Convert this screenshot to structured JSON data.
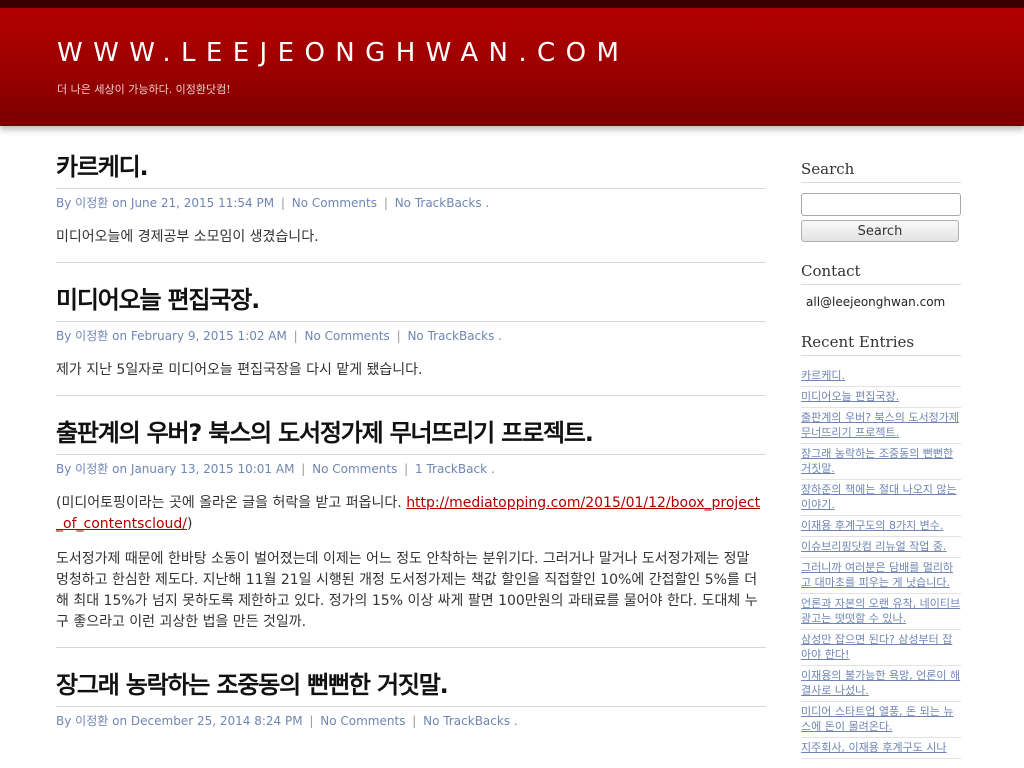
{
  "header": {
    "site_title": "WWW.LEEJEONGHWAN.COM",
    "tagline": "더 나은 세상이 가능하다. 이정환닷컴!"
  },
  "posts": [
    {
      "title": "카르케디.",
      "meta": {
        "by": "By",
        "author": "이정환",
        "on": "on",
        "date": "June 21, 2015 11:54 PM",
        "comments": "No Comments",
        "trackbacks": "No TrackBacks",
        "end": "."
      },
      "body": [
        "미디어오늘에 경제공부 소모임이 생겼습니다."
      ]
    },
    {
      "title": "미디어오늘 편집국장.",
      "meta": {
        "by": "By",
        "author": "이정환",
        "on": "on",
        "date": "February 9, 2015 1:02 AM",
        "comments": "No Comments",
        "trackbacks": "No TrackBacks",
        "end": "."
      },
      "body": [
        "제가 지난 5일자로 미디어오늘 편집국장을 다시 맡게 됐습니다."
      ]
    },
    {
      "title": "출판계의 우버? 북스의 도서정가제 무너뜨리기 프로젝트.",
      "meta": {
        "by": "By",
        "author": "이정환",
        "on": "on",
        "date": "January 13, 2015 10:01 AM",
        "comments": "No Comments",
        "trackbacks": "1 TrackBack",
        "end": "."
      },
      "intro_text": "(미디어토핑이라는 곳에 올라온 글을 허락을 받고 퍼옵니다. ",
      "intro_link": "http://mediatopping.com/2015/01/12/boox_project_of_contentscloud/",
      "intro_close": ")",
      "body": [
        "도서정가제 때문에 한바탕 소동이 벌어졌는데 이제는 어느 정도 안착하는 분위기다. 그러거나 말거나 도서정가제는 정말 멍청하고 한심한 제도다. 지난해 11월 21일 시행된 개정 도서정가제는 책값 할인을 직접할인 10%에 간접할인 5%를 더해 최대 15%가 넘지 못하도록 제한하고 있다. 정가의 15% 이상 싸게 팔면 100만원의 과태료를 물어야 한다. 도대체 누구 좋으라고 이런 괴상한 법을 만든 것일까."
      ]
    },
    {
      "title": "장그래 농락하는 조중동의 뻔뻔한 거짓말.",
      "meta": {
        "by": "By",
        "author": "이정환",
        "on": "on",
        "date": "December 25, 2014 8:24 PM",
        "comments": "No Comments",
        "trackbacks": "No TrackBacks",
        "end": "."
      },
      "body": []
    }
  ],
  "sidebar": {
    "search_title": "Search",
    "search_button": "Search",
    "contact_title": "Contact",
    "contact_email": "all@leejeonghwan.com",
    "recent_title": "Recent Entries",
    "recent_entries": [
      "카르케디.",
      "미디어오늘 편집국장.",
      "출판계의 우버? 북스의 도서정가제 무너뜨리기 프로젝트.",
      "장그래 농락하는 조중동의 뻔뻔한 거짓말.",
      "장하준의 책에는 절대 나오지 않는 이야기.",
      "이재용 후계구도의 8가지 변수.",
      "이슈브리핑닷컴 리뉴얼 작업 중.",
      "그러니까 여러분은 담배를 멀리하고 대마초를 피우는 게 낫습니다.",
      "언론과 자본의 오랜 유착, 네이티브 광고는 떳떳할 수 있나.",
      "삼성만 잡으면 된다? 삼성부터 잡아야 한다!",
      "이재용의 불가능한 욕망, 언론이 해결사로 나섰나.",
      "미디어 스타트업 열풍, 돈 되는 뉴스에 돈이 몰려온다.",
      "지주회사, 이재용 후계구도 시나"
    ]
  }
}
